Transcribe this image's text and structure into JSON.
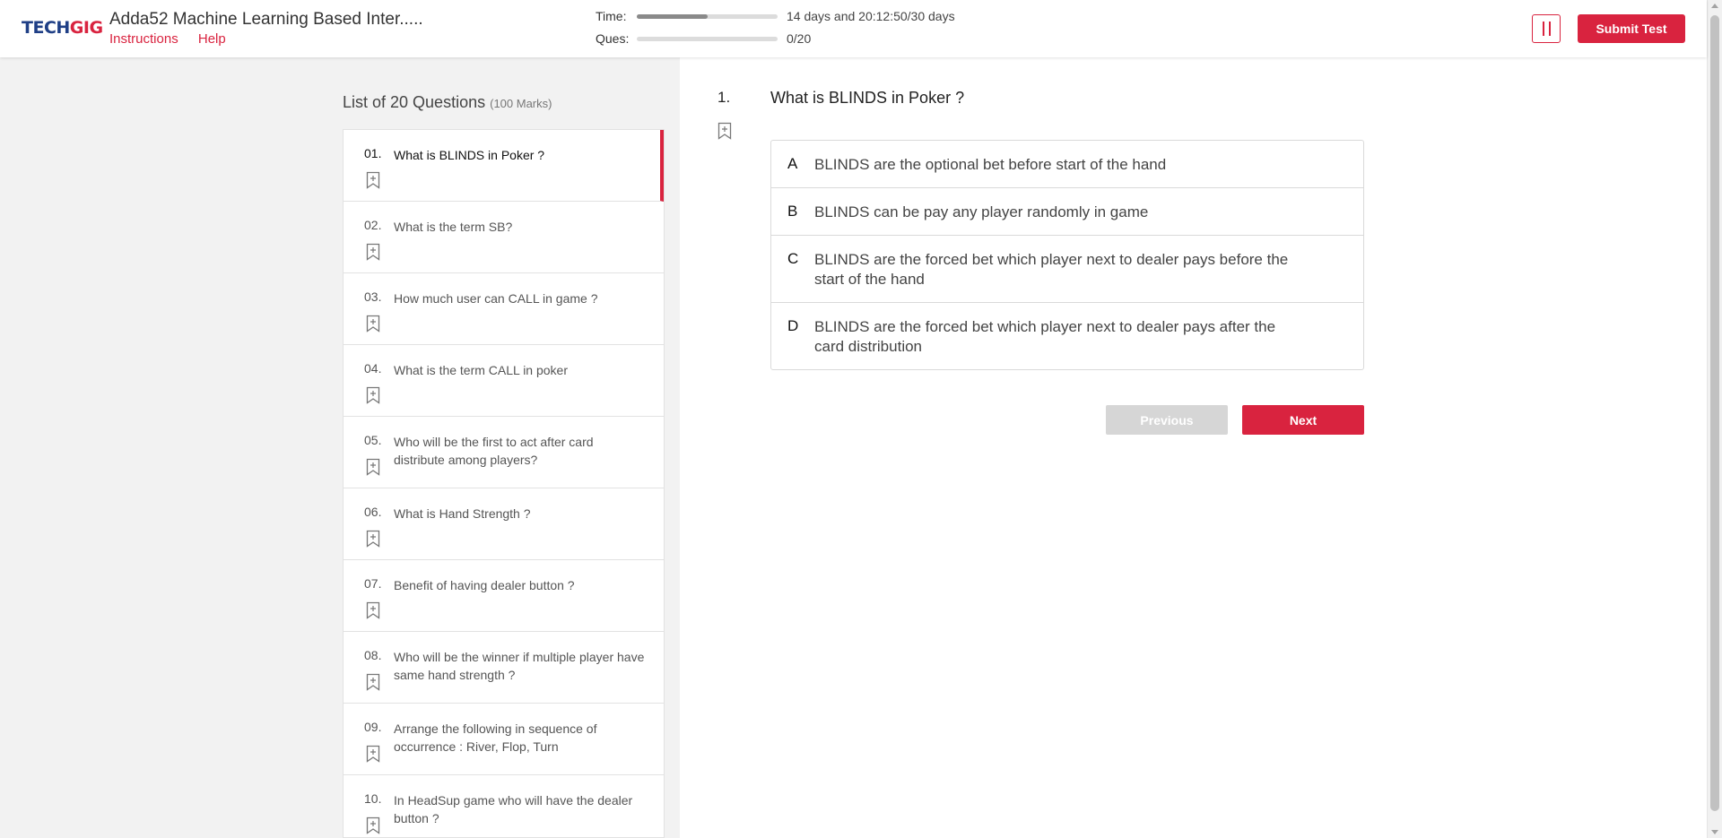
{
  "header": {
    "logo": {
      "part1": "TECH",
      "part2": "GIG"
    },
    "title": "Adda52 Machine Learning Based Inter.....",
    "links": [
      "Instructions",
      "Help"
    ],
    "time_label": "Time:",
    "time_value": "14 days and 20:12:50/30 days",
    "time_progress": 0.5,
    "ques_label": "Ques:",
    "ques_value": "0/20",
    "ques_progress": 0,
    "pause_icon": "pause-icon",
    "submit_label": "Submit Test"
  },
  "sidebar": {
    "title": "List of 20 Questions",
    "marks": "(100 Marks)",
    "questions": [
      {
        "num": "01.",
        "text": "What is BLINDS in Poker ?"
      },
      {
        "num": "02.",
        "text": "What is the term SB?"
      },
      {
        "num": "03.",
        "text": "How much user can CALL in game ?"
      },
      {
        "num": "04.",
        "text": "What is the term CALL in poker"
      },
      {
        "num": "05.",
        "text": "Who will be the first to act after card distribute among players?"
      },
      {
        "num": "06.",
        "text": "What is Hand Strength ?"
      },
      {
        "num": "07.",
        "text": "Benefit of having dealer button ?"
      },
      {
        "num": "08.",
        "text": "Who will be the winner if multiple player have same hand strength ?"
      },
      {
        "num": "09.",
        "text": "Arrange the following in sequence of occurrence : River, Flop, Turn"
      },
      {
        "num": "10.",
        "text": "In HeadSup game who will have the dealer button ?"
      }
    ]
  },
  "question": {
    "num": "1.",
    "title": "What is BLINDS in Poker ?",
    "options": [
      {
        "letter": "A",
        "text": "BLINDS are the optional bet before start of the hand"
      },
      {
        "letter": "B",
        "text": "BLINDS can be pay any player randomly in game"
      },
      {
        "letter": "C",
        "text": "BLINDS are the forced bet which player next to dealer pays before the start of the hand"
      },
      {
        "letter": "D",
        "text": "BLINDS are the forced bet which player next to dealer pays after the card distribution"
      }
    ],
    "prev_label": "Previous",
    "next_label": "Next"
  },
  "colors": {
    "brand_red": "#d9233f",
    "brand_blue": "#1f3f86"
  }
}
